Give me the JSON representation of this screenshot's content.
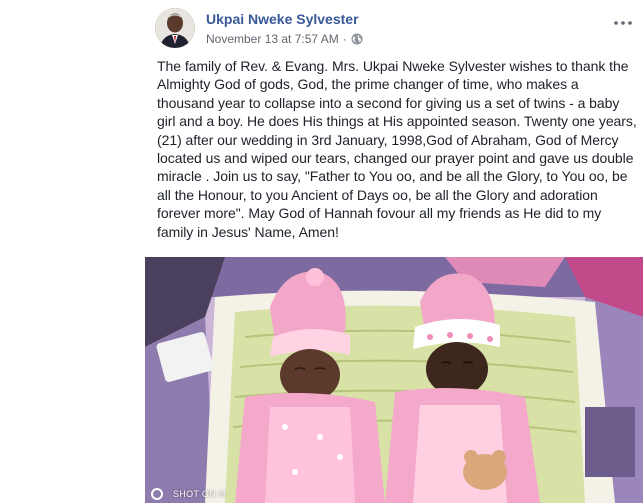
{
  "post": {
    "author": "Ukpai Nweke Sylvester",
    "timestamp": "November 13 at 7:57 AM",
    "separator": "·",
    "privacy_icon": "globe-icon",
    "more_icon": "more-options-icon",
    "text": "The family of Rev. & Evang. Mrs. Ukpai Nweke Sylvester wishes to thank the Almighty God of gods, God, the prime changer of time, who makes a thousand year to collapse into a second for giving us a set of twins - a baby girl and a boy. He does His things at His appointed season. Twenty one years, (21) after our wedding in 3rd January, 1998,God of Abraham, God of Mercy located us and wiped our tears, changed our prayer point and gave us double miracle . Join us to say, \"Father to You oo, and be all the Glory, to You oo, be all the Honour, to you Ancient of Days oo, be all the Glory and adoration forever more\". May God of Hannah fovour all my friends as He did to my family in Jesus' Name, Amen!",
    "photo": {
      "watermark": "SHOT ON H"
    }
  },
  "colors": {
    "author_link": "#385898",
    "meta_text": "#616770",
    "body_text": "#1d2129"
  }
}
